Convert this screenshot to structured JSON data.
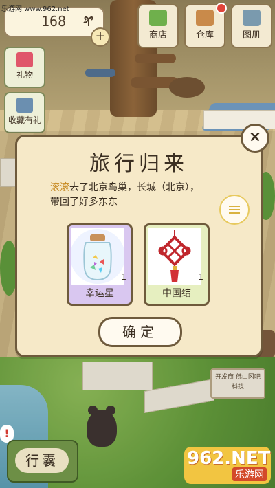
{
  "watermark": "乐游网 www.962.net",
  "hud": {
    "clover_count": "168",
    "clover_icon": "clover-icon",
    "plus_label": "+",
    "shop_label": "商店",
    "storage_label": "仓库",
    "album_label": "图册",
    "gift_label": "礼物",
    "collection_label": "收藏有礼",
    "alert_label": "!"
  },
  "dialog": {
    "title": "旅行归来",
    "traveler_name": "滚滚",
    "message_line1_rest": "去了北京鸟巢，长城（北京），",
    "message_line2": "带回了好多东东",
    "items": [
      {
        "label": "幸运星",
        "count": "1",
        "icon": "lucky-stars-jar-icon"
      },
      {
        "label": "中国结",
        "count": "1",
        "icon": "chinese-knot-icon"
      }
    ],
    "confirm_label": "确定",
    "close_label": "×"
  },
  "bottom": {
    "bag_label": "行囊"
  },
  "scene": {
    "sign_text": "开发商 佛山冈吧科技"
  },
  "logo": {
    "main": "962.NET",
    "sub": "乐游网"
  },
  "colors": {
    "dialog_bg": "#f6e9c8",
    "dialog_border": "#6e5a3c",
    "name_highlight": "#c78a22",
    "card1_bg": "#d9c7f0",
    "card2_bg": "#e6efc0",
    "logo_bg": "#f2c541"
  }
}
